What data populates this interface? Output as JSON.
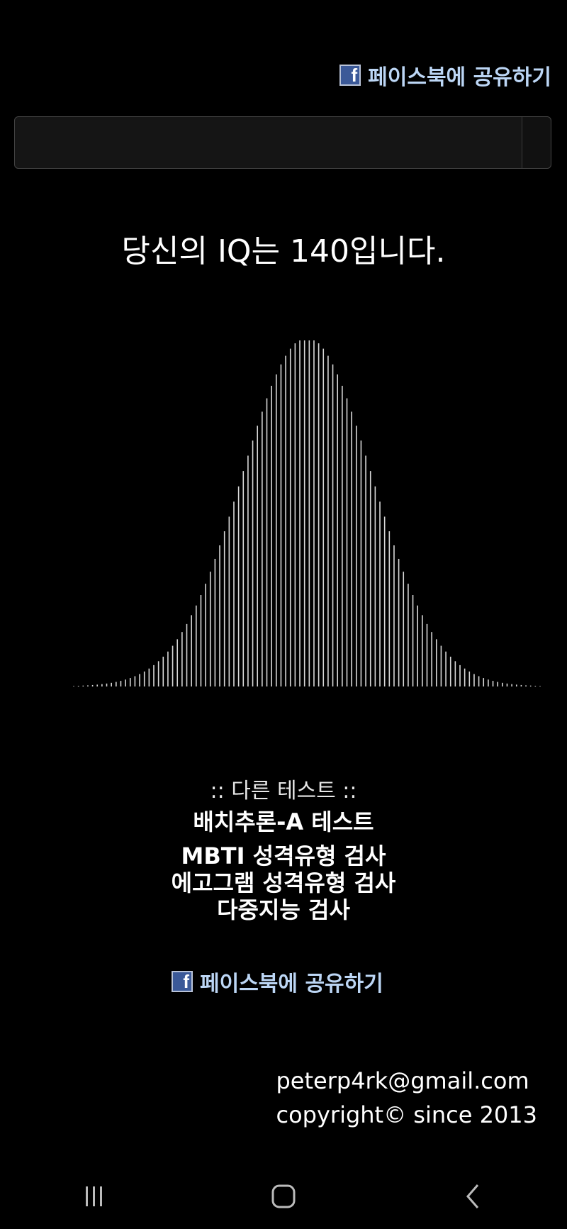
{
  "share": {
    "label": "페이스북에 공유하기",
    "icon": "facebook-icon"
  },
  "search": {
    "value": "",
    "placeholder": ""
  },
  "result": {
    "text": "당신의 IQ는 140입니다."
  },
  "chart_data": {
    "type": "bar",
    "distribution": "normal",
    "mean": 100,
    "sd": 15,
    "bar_count": 100,
    "title": "",
    "xlabel": "",
    "ylabel": ""
  },
  "other_tests": {
    "header": ":: 다른 테스트 ::",
    "items": [
      {
        "label": "배치추론-A 테스트"
      },
      {
        "label": "MBTI 성격유형 검사"
      },
      {
        "label": "에고그램 성격유형 검사"
      },
      {
        "label": "다중지능 검사"
      }
    ]
  },
  "footer": {
    "email": "peterp4rk@gmail.com",
    "copyright": "copyright© since 2013"
  },
  "navbar": {
    "items": [
      "recent-apps-icon",
      "home-icon",
      "back-icon"
    ]
  }
}
